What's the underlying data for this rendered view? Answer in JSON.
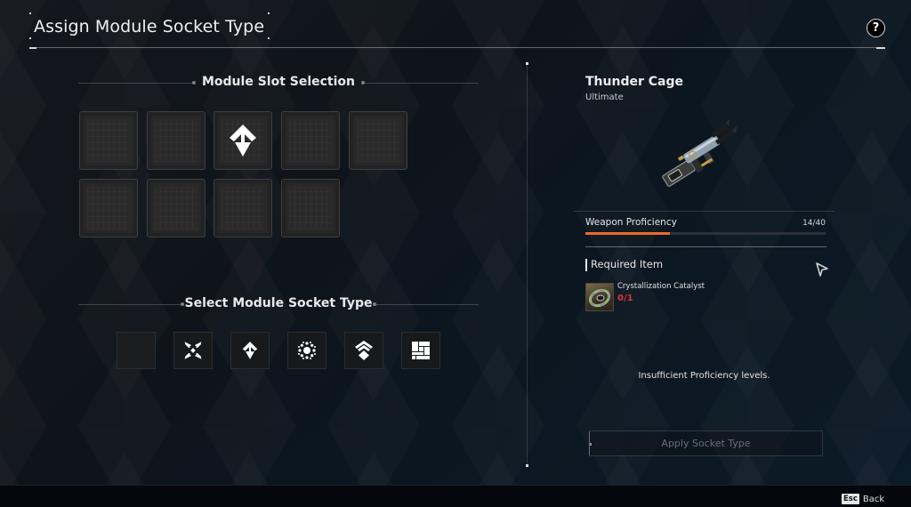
{
  "header": {
    "title": "Assign Module Socket Type",
    "help_icon": "question-mark-icon",
    "help_label": "?"
  },
  "slot_selection": {
    "title": "Module Slot Selection",
    "slots": [
      {
        "index": 1,
        "socket": null
      },
      {
        "index": 2,
        "socket": null
      },
      {
        "index": 3,
        "socket": "split-arrow-icon",
        "selected": true
      },
      {
        "index": 4,
        "socket": null
      },
      {
        "index": 5,
        "socket": null
      },
      {
        "index": 6,
        "socket": null
      },
      {
        "index": 7,
        "socket": null
      },
      {
        "index": 8,
        "socket": null
      },
      {
        "index": 9,
        "socket": null
      }
    ]
  },
  "socket_types": {
    "title": "Select Module Socket Type",
    "options": [
      {
        "name": "none",
        "icon": "empty-socket-icon"
      },
      {
        "name": "converge",
        "icon": "converging-arrows-icon"
      },
      {
        "name": "split",
        "icon": "split-arrow-icon"
      },
      {
        "name": "burst",
        "icon": "burst-dots-icon"
      },
      {
        "name": "ascend",
        "icon": "chevron-diamond-icon"
      },
      {
        "name": "blocks",
        "icon": "blocks-icon"
      }
    ]
  },
  "weapon": {
    "name": "Thunder Cage",
    "rarity": "Ultimate",
    "image_icon": "rifle-icon"
  },
  "proficiency": {
    "label": "Weapon Proficiency",
    "current": 14,
    "max": 40,
    "value_text": "14/40",
    "fill_fraction": 0.35,
    "color": "#ee6a2b"
  },
  "required": {
    "title": "Required Item",
    "item_name": "Crystallization Catalyst",
    "item_count": "0/1",
    "count_color": "#d9363b"
  },
  "message": "Insufficient Proficiency levels.",
  "apply_button": {
    "label": "Apply Socket Type",
    "enabled": false
  },
  "footer": {
    "key": "Esc",
    "label": "Back"
  }
}
